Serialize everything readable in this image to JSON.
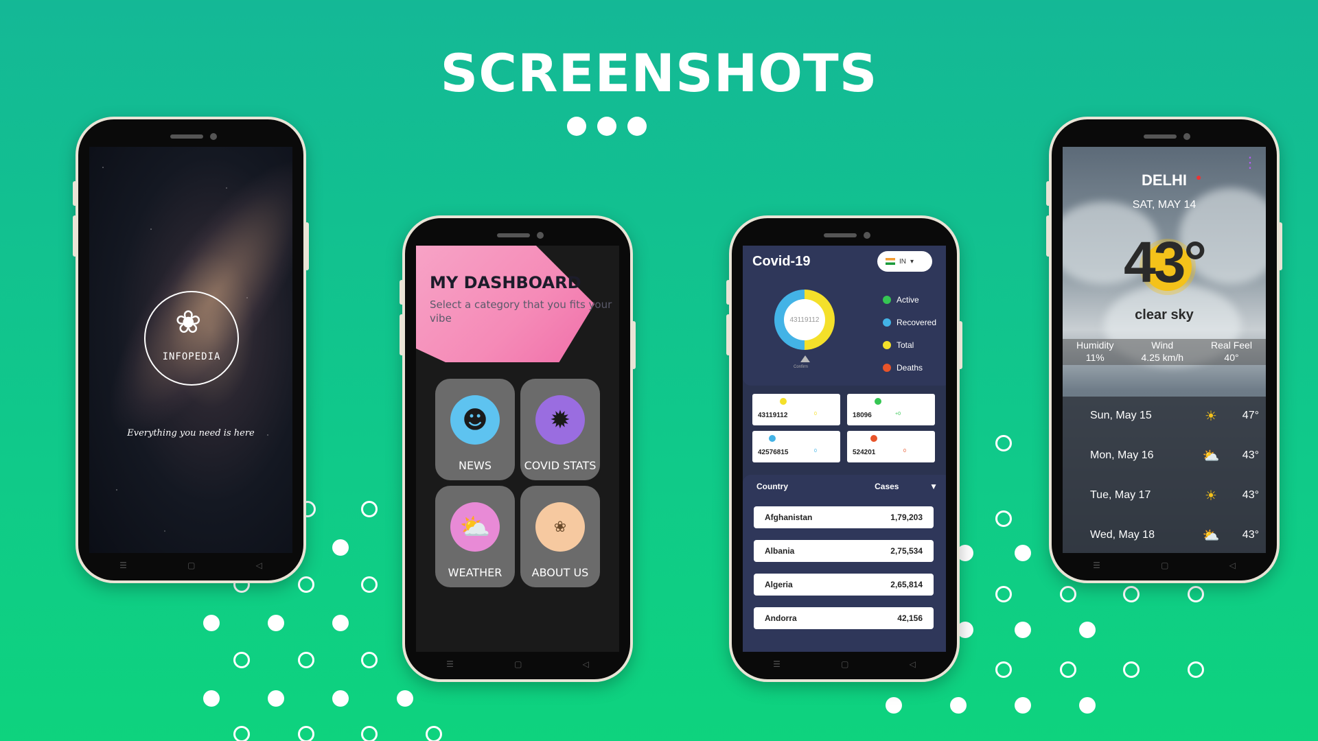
{
  "page": {
    "title": "SCREENSHOTS"
  },
  "splash": {
    "logo_text": "INFOPEDIA",
    "tagline": "Everything you need is here"
  },
  "dashboard": {
    "title": "MY DASHBOARD",
    "subtitle": "Select a category that you fits your vibe",
    "tiles": [
      {
        "label": "NEWS",
        "icon": "news-reader-icon"
      },
      {
        "label": "COVID STATS",
        "icon": "virus-icon"
      },
      {
        "label": "WEATHER",
        "icon": "sun-cloud-icon"
      },
      {
        "label": "ABOUT US",
        "icon": "infopedia-logo-icon"
      }
    ]
  },
  "covid": {
    "title": "Covid-19",
    "country_code": "IN",
    "donut_center": "43119112",
    "donut_caption": "Confirm",
    "legend": [
      {
        "label": "Active",
        "color": "#35c653"
      },
      {
        "label": "Recovered",
        "color": "#43b3e6"
      },
      {
        "label": "Total",
        "color": "#f4e02a"
      },
      {
        "label": "Deaths",
        "color": "#e8542a"
      }
    ],
    "stats": [
      {
        "value": "43119112",
        "delta": "0",
        "color": "#f4e02a"
      },
      {
        "value": "18096",
        "delta": "+0",
        "color": "#35c653"
      },
      {
        "value": "42576815",
        "delta": "0",
        "color": "#43b3e6"
      },
      {
        "value": "524201",
        "delta": "0",
        "color": "#e8542a"
      }
    ],
    "table_headers": {
      "country": "Country",
      "cases": "Cases"
    },
    "rows": [
      {
        "country": "Afghanistan",
        "cases": "1,79,203"
      },
      {
        "country": "Albania",
        "cases": "2,75,534"
      },
      {
        "country": "Algeria",
        "cases": "2,65,814"
      },
      {
        "country": "Andorra",
        "cases": "42,156"
      }
    ]
  },
  "weather": {
    "city": "DELHI",
    "date": "SAT, MAY 14",
    "temp": "43°",
    "condition": "clear sky",
    "metrics": [
      {
        "label": "Humidity",
        "value": "11%"
      },
      {
        "label": "Wind",
        "value": "4.25 km/h"
      },
      {
        "label": "Real Feel",
        "value": "40°"
      }
    ],
    "forecast": [
      {
        "day": "Sun, May 15",
        "temp": "47°",
        "icon": "sun-icon"
      },
      {
        "day": "Mon, May 16",
        "temp": "43°",
        "icon": "cloud-sun-icon"
      },
      {
        "day": "Tue, May 17",
        "temp": "43°",
        "icon": "sun-icon"
      },
      {
        "day": "Wed, May 18",
        "temp": "43°",
        "icon": "cloud-sun-icon"
      }
    ]
  }
}
